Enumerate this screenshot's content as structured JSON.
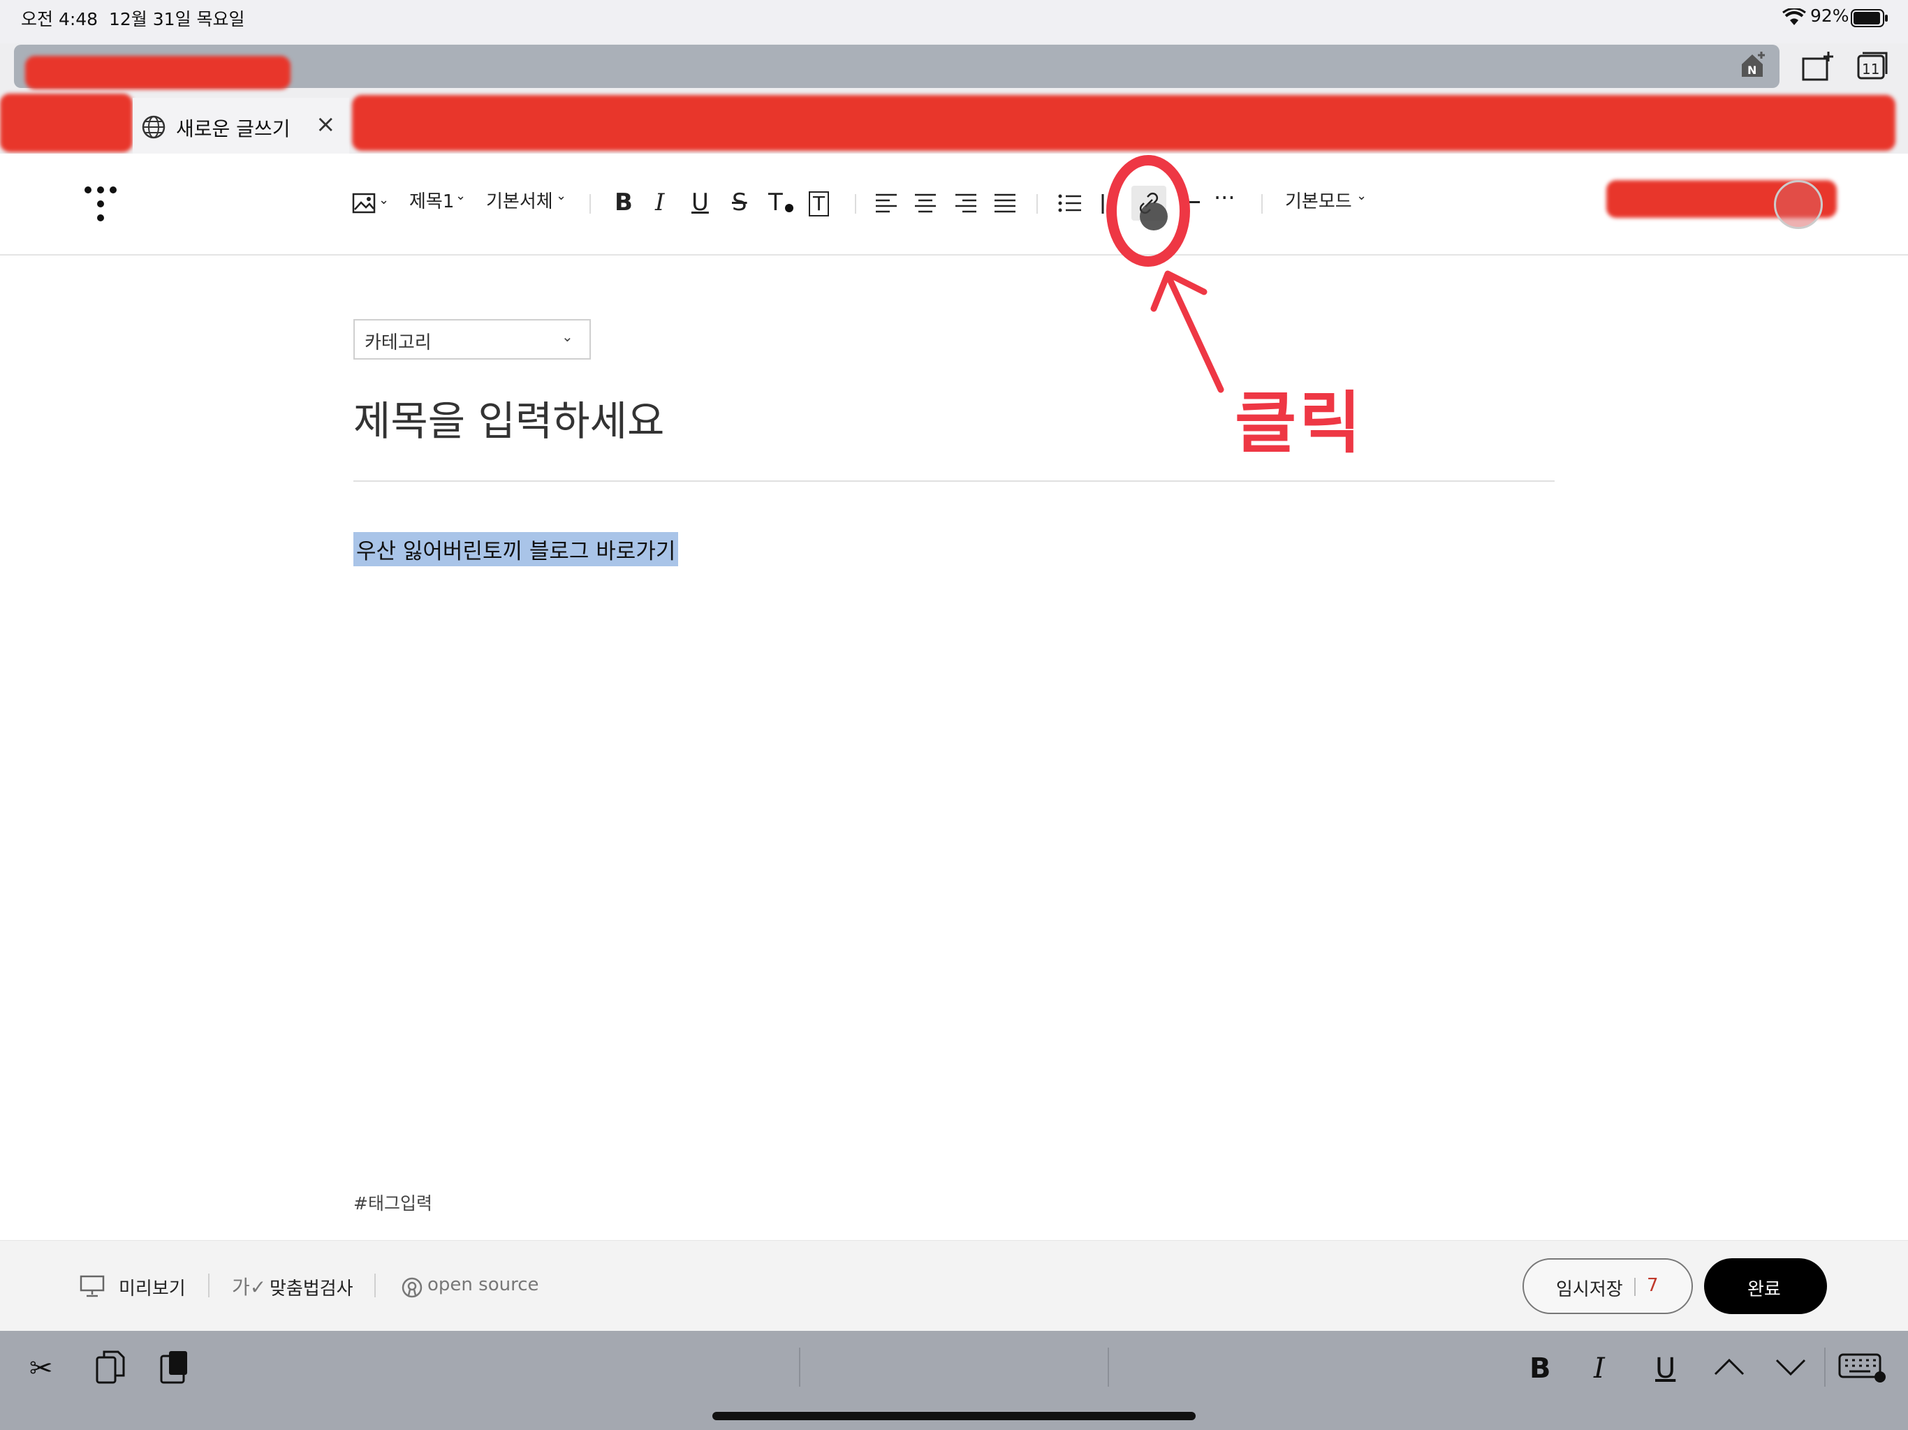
{
  "status_bar": {
    "time": "오전 4:48",
    "date": "12월 31일 목요일",
    "battery": "92%"
  },
  "browser": {
    "tab_title": "새로운 글쓰기",
    "tab_close": "×",
    "tabs_count": "11"
  },
  "toolbar": {
    "heading_style": "제목1",
    "font_family": "기본서체",
    "bold": "B",
    "italic": "I",
    "underline": "U",
    "strike": "S",
    "text_color": "T",
    "text_bg": "T",
    "more": "···",
    "mode": "기본모드"
  },
  "editor": {
    "category_placeholder": "카테고리",
    "title_placeholder": "제목을 입력하세요",
    "body_text": "우산 잃어버린토끼 블로그 바로가기",
    "tag_placeholder": "#태그입력"
  },
  "annotation": {
    "label": "클릭",
    "color": "#ee3744"
  },
  "footer": {
    "preview_label": "미리보기",
    "spellcheck_label": "맞춤법검사",
    "open_source_label": "open source",
    "save_draft_label": "임시저장",
    "draft_count": "7",
    "done_label": "완료"
  },
  "keyboard_bar": {
    "bold": "B",
    "italic": "I",
    "underline": "U"
  }
}
